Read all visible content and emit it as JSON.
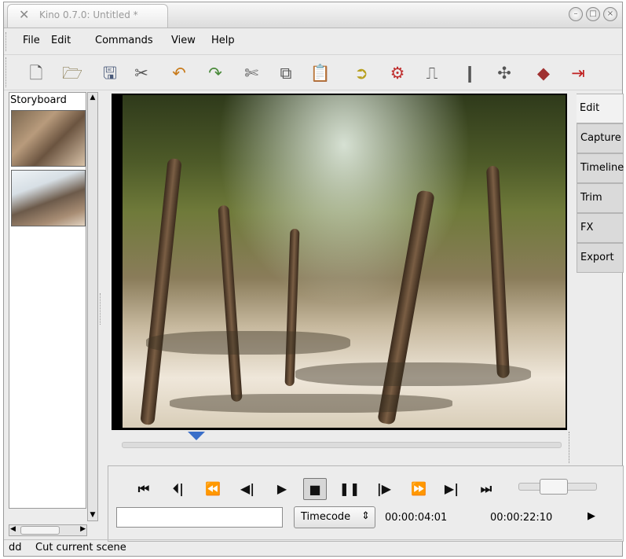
{
  "window": {
    "title": "Kino 0.7.0: Untitled *"
  },
  "menubar": {
    "items": [
      "File",
      "Edit",
      "Commands",
      "View",
      "Help"
    ]
  },
  "toolbar": {
    "icons": [
      "new-file-icon",
      "open-folder-icon",
      "save-icon",
      "preferences-icon",
      "undo-icon",
      "redo-icon",
      "cut-icon",
      "copy-icon",
      "paste-icon",
      "publish-icon",
      "settings-icon",
      "split-scene-icon",
      "info-icon",
      "effects-icon",
      "erase-icon",
      "exit-icon"
    ]
  },
  "storyboard": {
    "label": "Storyboard"
  },
  "tabs": [
    "Edit",
    "Capture",
    "Timeline",
    "Trim",
    "FX",
    "Export"
  ],
  "active_tab": "Edit",
  "scrubber": {
    "position_fraction": 0.17
  },
  "transport": {
    "buttons": [
      "first-frame",
      "previous-scene",
      "rewind",
      "previous-frame",
      "play",
      "stop",
      "pause",
      "next-frame",
      "fast-forward",
      "next-scene",
      "last-frame"
    ],
    "jog_position_fraction": 0.45
  },
  "timecode": {
    "format": "Timecode",
    "current": "00:00:04:01",
    "total": "00:00:22:10"
  },
  "status": {
    "left": "dd",
    "message": "Cut current scene"
  }
}
